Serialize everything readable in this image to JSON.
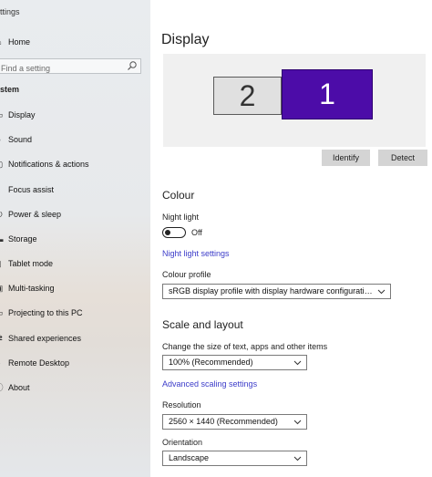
{
  "window": {
    "title": "ttings"
  },
  "sidebar": {
    "home": {
      "label": "Home",
      "icon": "home-icon"
    },
    "search_placeholder": "Find a setting",
    "section_header": "stem",
    "items": [
      {
        "label": "Display",
        "icon": "monitor-icon"
      },
      {
        "label": "Sound",
        "icon": "speaker-icon"
      },
      {
        "label": "Notifications & actions",
        "icon": "notifications-icon"
      },
      {
        "label": "Focus assist",
        "icon": "moon-icon"
      },
      {
        "label": "Power & sleep",
        "icon": "power-icon"
      },
      {
        "label": "Storage",
        "icon": "storage-icon"
      },
      {
        "label": "Tablet mode",
        "icon": "tablet-icon"
      },
      {
        "label": "Multi-tasking",
        "icon": "multitask-icon"
      },
      {
        "label": "Projecting to this PC",
        "icon": "projector-icon"
      },
      {
        "label": "Shared experiences",
        "icon": "shared-icon"
      },
      {
        "label": "Remote Desktop",
        "icon": "remote-icon"
      },
      {
        "label": "About",
        "icon": "info-icon"
      }
    ]
  },
  "main": {
    "title": "Display",
    "monitors": [
      {
        "number": "2"
      },
      {
        "number": "1"
      }
    ],
    "identify_label": "Identify",
    "detect_label": "Detect",
    "colour": {
      "heading": "Colour",
      "night_light_label": "Night light",
      "night_light_state": "Off",
      "night_light_settings_link": "Night light settings",
      "colour_profile_label": "Colour profile",
      "colour_profile_value": "sRGB display profile with display hardware configuration d..."
    },
    "scale": {
      "heading": "Scale and layout",
      "size_label": "Change the size of text, apps and other items",
      "size_value": "100% (Recommended)",
      "advanced_link": "Advanced scaling settings",
      "resolution_label": "Resolution",
      "resolution_value": "2560 × 1440 (Recommended)",
      "orientation_label": "Orientation",
      "orientation_value": "Landscape"
    }
  },
  "colors": {
    "accent": "#4c0ca8",
    "link": "#3b3bc9",
    "button_bg": "#d4d4d4"
  }
}
